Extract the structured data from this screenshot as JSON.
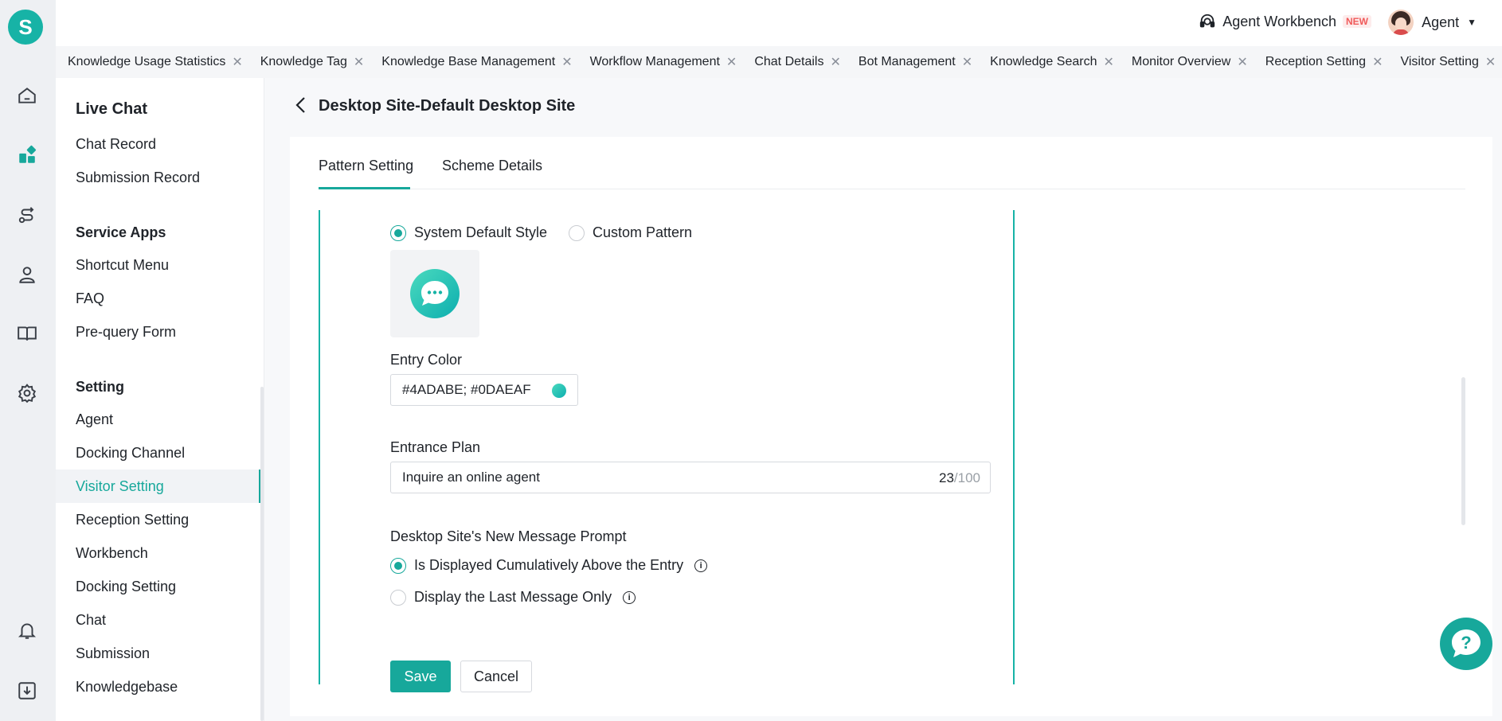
{
  "app": {
    "logo_letter": "S"
  },
  "topbar": {
    "workbench_label": "Agent Workbench",
    "workbench_badge": "NEW",
    "user_name": "Agent"
  },
  "tabs": [
    {
      "label": "Knowledge Usage Statistics"
    },
    {
      "label": "Knowledge Tag"
    },
    {
      "label": "Knowledge Base Management"
    },
    {
      "label": "Workflow Management"
    },
    {
      "label": "Chat Details"
    },
    {
      "label": "Bot Management"
    },
    {
      "label": "Knowledge Search"
    },
    {
      "label": "Monitor Overview"
    },
    {
      "label": "Reception Setting"
    },
    {
      "label": "Visitor Setting"
    }
  ],
  "sidebar": {
    "groups": [
      {
        "title": "Live Chat",
        "items": [
          "Chat Record",
          "Submission Record"
        ]
      },
      {
        "title": "Service Apps",
        "items": [
          "Shortcut Menu",
          "FAQ",
          "Pre-query Form"
        ]
      },
      {
        "title": "Setting",
        "items": [
          "Agent",
          "Docking Channel",
          "Visitor Setting",
          "Reception Setting",
          "Workbench",
          "Docking Setting",
          "Chat",
          "Submission",
          "Knowledgebase"
        ]
      }
    ],
    "active_item": "Visitor Setting"
  },
  "page": {
    "title": "Desktop Site-Default Desktop Site",
    "subtabs": [
      "Pattern Setting",
      "Scheme Details"
    ],
    "active_subtab": "Pattern Setting"
  },
  "form": {
    "style_options": [
      "System Default Style",
      "Custom Pattern"
    ],
    "selected_style": "System Default Style",
    "entry_color_label": "Entry Color",
    "entry_color_value": "#4ADABE; #0DAEAF",
    "entry_colors": [
      "#4ADABE",
      "#0DAEAF"
    ],
    "entrance_plan_label": "Entrance Plan",
    "entrance_plan_value": "Inquire an online agent",
    "entrance_plan_count": "23",
    "entrance_plan_max": "/100",
    "prompt_label": "Desktop Site's New Message Prompt",
    "prompt_options": [
      "Is Displayed Cumulatively Above the Entry",
      "Display the Last Message Only"
    ],
    "selected_prompt": "Is Displayed Cumulatively Above the Entry",
    "save_label": "Save",
    "cancel_label": "Cancel"
  },
  "colors": {
    "accent": "#17A89B",
    "brand": "#17B3A6"
  }
}
